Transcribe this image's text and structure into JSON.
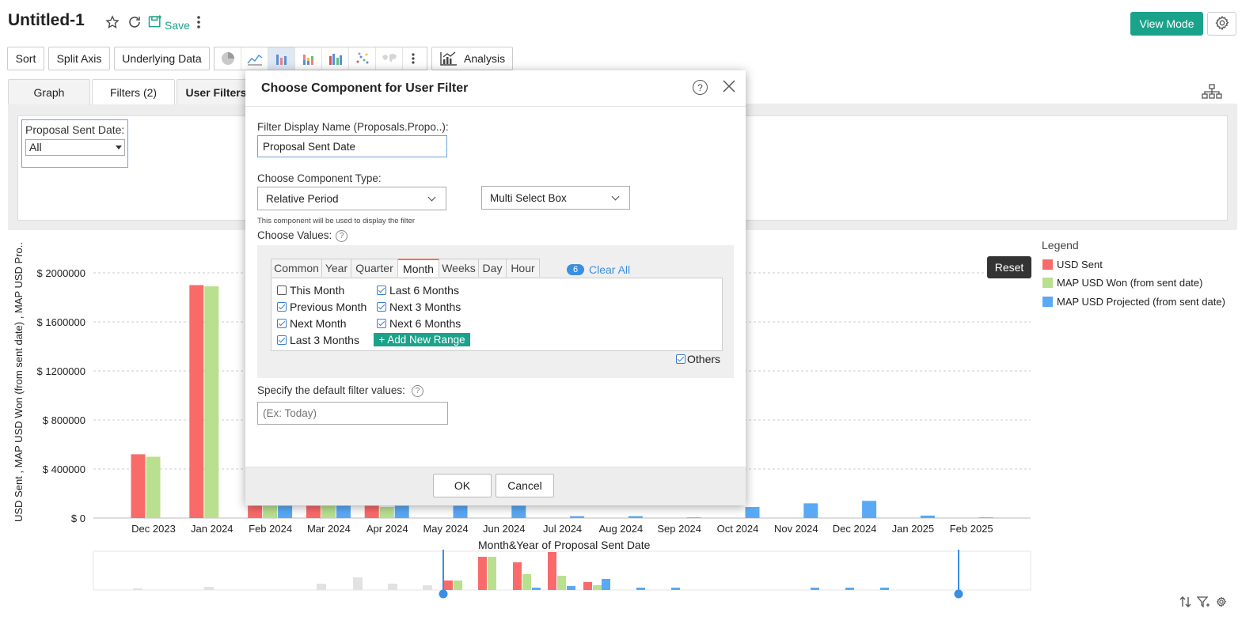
{
  "header": {
    "title": "Untitled-1",
    "save_label": "Save",
    "view_mode_label": "View Mode"
  },
  "toolbar": {
    "sort_label": "Sort",
    "split_axis_label": "Split Axis",
    "underlying_data_label": "Underlying Data",
    "analysis_label": "Analysis",
    "chart_icons": [
      "pie-chart-icon",
      "line-chart-icon",
      "bar-chart-icon",
      "stacked-bar-icon",
      "grouped-bar-icon",
      "scatter-icon",
      "map-icon",
      "more-vertical-icon"
    ]
  },
  "tabs": [
    {
      "label": "Graph"
    },
    {
      "label": "Filters  (2)"
    },
    {
      "label": "User Filters"
    }
  ],
  "user_filter": {
    "label": "Proposal Sent Date:",
    "value": "All"
  },
  "modal": {
    "title": "Choose Component for User Filter",
    "display_name_label": "Filter Display Name (Proposals.Propo..):",
    "display_name_value": "Proposal Sent Date",
    "component_type_label": "Choose Component Type:",
    "component_type_value": "Relative Period",
    "component_sub_value": "Multi Select Box",
    "component_hint": "This component will be used to display the filter",
    "choose_values_label": "Choose Values:",
    "value_tabs": [
      "Common",
      "Year",
      "Quarter",
      "Month",
      "Weeks",
      "Day",
      "Hour"
    ],
    "selected_tab": "Month",
    "selected_count": "6",
    "clear_all_label": "Clear All",
    "options_col1": [
      {
        "label": "This Month",
        "checked": false
      },
      {
        "label": "Previous Month",
        "checked": true
      },
      {
        "label": "Next Month",
        "checked": true
      },
      {
        "label": "Last 3 Months",
        "checked": true
      }
    ],
    "options_col2": [
      {
        "label": "Last 6 Months",
        "checked": true
      },
      {
        "label": "Next 3 Months",
        "checked": true
      },
      {
        "label": "Next 6 Months",
        "checked": true
      }
    ],
    "add_range_label": "+ Add New Range",
    "others_label": "Others",
    "default_values_label": "Specify the default filter values:",
    "default_values_placeholder": "(Ex: Today)",
    "ok_label": "OK",
    "cancel_label": "Cancel"
  },
  "legend": {
    "title": "Legend",
    "items": [
      {
        "label": "USD Sent",
        "color": "#f96a6a"
      },
      {
        "label": "MAP USD Won (from sent date)",
        "color": "#b8e08e"
      },
      {
        "label": "MAP USD Projected (from sent date)",
        "color": "#5aa9f5"
      }
    ]
  },
  "reset_label": "Reset",
  "chart_data": {
    "type": "bar",
    "xlabel": "Month&Year of Proposal Sent Date",
    "ylabel": "USD Sent , MAP USD Won (from sent date) , MAP USD Pro..",
    "ylim": [
      0,
      2000000
    ],
    "yticks": [
      "$ 0",
      "$ 400000",
      "$ 800000",
      "$ 1200000",
      "$ 1600000",
      "$ 2000000"
    ],
    "ytick_values": [
      0,
      400000,
      800000,
      1200000,
      1600000,
      2000000
    ],
    "grid": true,
    "legend_position": "right",
    "categories": [
      "Dec 2023",
      "Jan 2024",
      "Feb 2024",
      "Mar 2024",
      "Apr 2024",
      "May 2024",
      "Jun 2024",
      "Jul 2024",
      "Aug 2024",
      "Sep 2024",
      "Oct 2024",
      "Nov 2024",
      "Dec 2024",
      "Jan 2025",
      "Feb 2025"
    ],
    "series": [
      {
        "name": "USD Sent",
        "values": [
          520000,
          1900000,
          100000,
          100000,
          100000,
          0,
          0,
          0,
          0,
          0,
          0,
          0,
          0,
          0,
          0
        ]
      },
      {
        "name": "MAP USD Won (from sent date)",
        "values": [
          500000,
          1890000,
          100000,
          100000,
          90000,
          0,
          0,
          0,
          0,
          0,
          0,
          0,
          0,
          0,
          0
        ]
      },
      {
        "name": "MAP USD Projected (from sent date)",
        "values": [
          0,
          0,
          100000,
          100000,
          100000,
          100000,
          100000,
          15000,
          15000,
          5000,
          90000,
          120000,
          140000,
          20000,
          5000
        ]
      }
    ]
  }
}
